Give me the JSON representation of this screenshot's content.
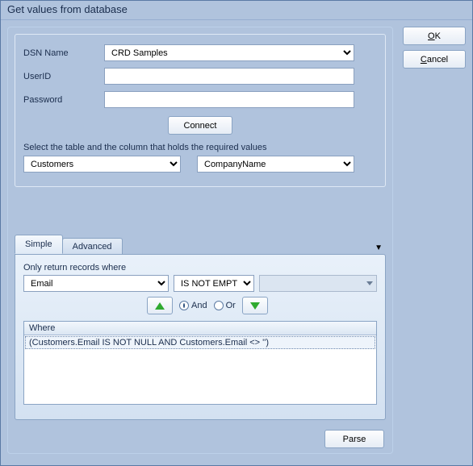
{
  "title": "Get values from database",
  "buttons": {
    "ok": "OK",
    "cancel": "Cancel",
    "connect": "Connect",
    "parse": "Parse"
  },
  "form": {
    "dsn_label": "DSN Name",
    "dsn_value": "CRD Samples",
    "userid_label": "UserID",
    "userid_value": "",
    "password_label": "Password",
    "password_value": ""
  },
  "hint": "Select the table and the column that holds the required values",
  "table_value": "Customers",
  "column_value": "CompanyName",
  "tabs": {
    "simple": "Simple",
    "advanced": "Advanced"
  },
  "filter": {
    "label": "Only return records where",
    "field": "Email",
    "operator": "IS NOT EMPTY",
    "and": "And",
    "or": "Or"
  },
  "grid": {
    "header": "Where",
    "row1": "(Customers.Email IS NOT NULL AND Customers.Email <> '')"
  }
}
